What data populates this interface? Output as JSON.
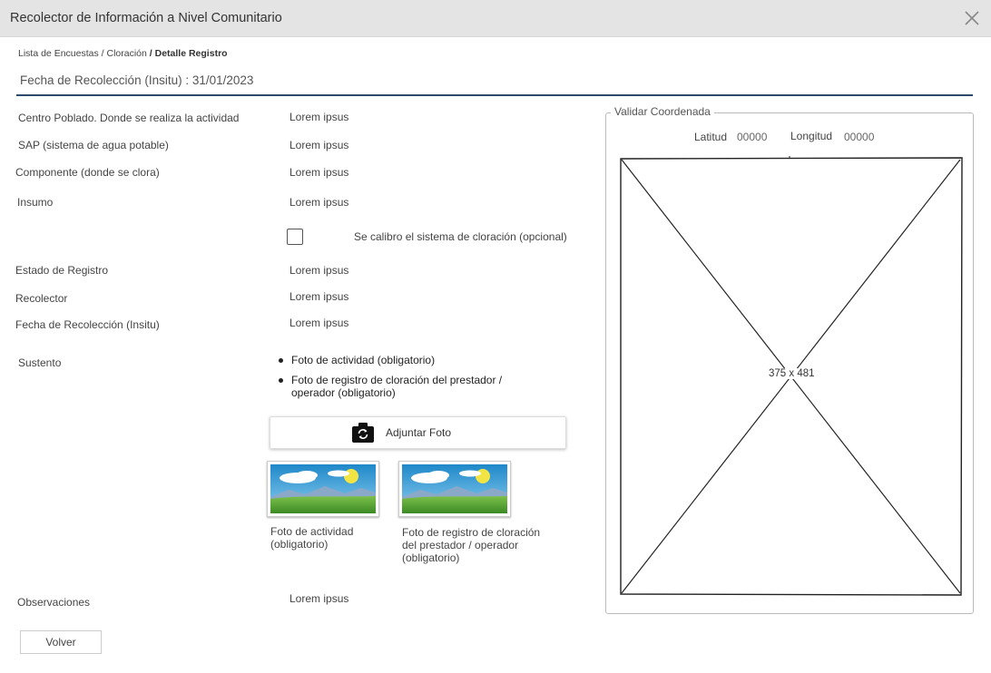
{
  "window": {
    "title": "Recolector de Información a Nivel Comunitario",
    "close_icon": "close-icon"
  },
  "breadcrumb": {
    "item1": "Lista de Encuestas",
    "sep1": " / ",
    "item2": "Cloración",
    "sep2": " / ",
    "current": "Detalle Registro"
  },
  "header": {
    "date_line": "Fecha de Recolección (Insitu) : 31/01/2023"
  },
  "fields": {
    "centro_poblado": {
      "label": "Centro Poblado. Donde se realiza la actividad",
      "value": "Lorem ipsus"
    },
    "sap": {
      "label": "SAP (sistema de agua potable)",
      "value": "Lorem ipsus"
    },
    "componente": {
      "label": "Componente (donde se clora)",
      "value": "Lorem ipsus"
    },
    "insumo": {
      "label": "Insumo",
      "value": "Lorem ipsus"
    },
    "calibracion": {
      "label": "Se calibro el sistema de cloración (opcional)",
      "checked": false
    },
    "estado": {
      "label": "Estado de Registro",
      "value": "Lorem ipsus"
    },
    "recolector": {
      "label": "Recolector",
      "value": "Lorem ipsus"
    },
    "fecha": {
      "label": "Fecha de Recolección (Insitu)",
      "value": "Lorem ipsus"
    },
    "observaciones": {
      "label": "Observaciones",
      "value": "Lorem ipsus"
    }
  },
  "sustento": {
    "label": "Sustento",
    "items": [
      "Foto de actividad (obligatorio)",
      "Foto de registro de cloración del prestador / operador (obligatorio)"
    ],
    "attach_label": "Adjuntar Foto",
    "attach_icon": "camera-icon",
    "photos": [
      {
        "caption": "Foto de actividad (obligatorio)",
        "icon": "landscape-image-icon"
      },
      {
        "caption": "Foto de registro de cloración del prestador / operador (obligatorio)",
        "icon": "landscape-image-icon"
      }
    ]
  },
  "coordinates": {
    "legend": "Validar Coordenada",
    "lat_label": "Latitud",
    "lat_value": "00000",
    "lon_label": "Longitud",
    "lon_value": "00000",
    "placeholder_text": "375 x 481"
  },
  "actions": {
    "back": "Volver"
  },
  "colors": {
    "titlebar": "#e4e4e4",
    "rule": "#2e4a6b",
    "sky": "#3aa0d6",
    "grass": "#4ea030",
    "sun": "#f2e443"
  }
}
